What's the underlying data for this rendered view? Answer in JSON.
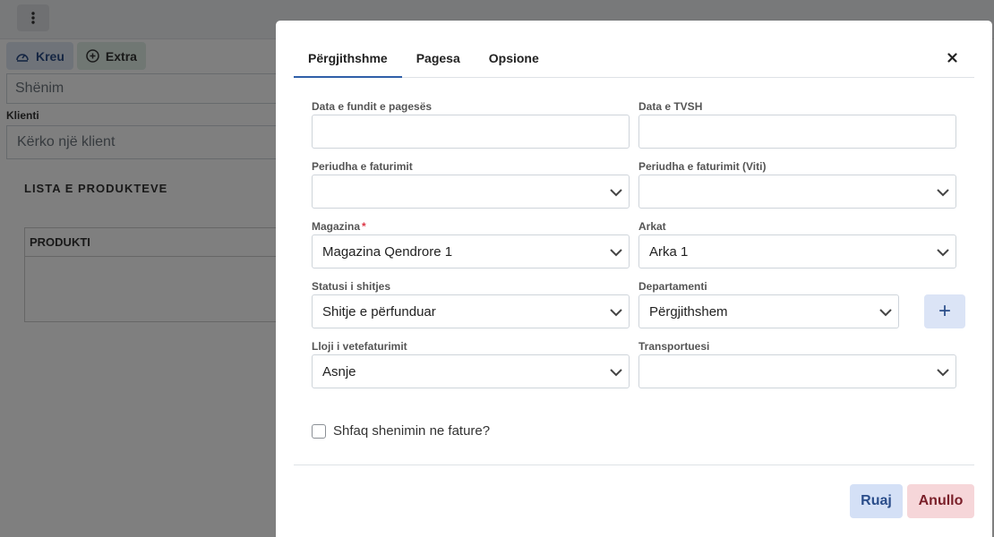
{
  "background": {
    "tabs": [
      {
        "label": "Kreu",
        "icon": "dashboard-icon"
      },
      {
        "label": "Extra",
        "icon": "plus-circle-icon"
      }
    ],
    "note_placeholder": "Shënim",
    "client_label": "Klienti",
    "client_placeholder": "Kërko një klient",
    "list_title": "LISTA E PRODUKTEVE",
    "table_header": "PRODUKTI"
  },
  "modal": {
    "tabs": [
      {
        "label": "Përgjithshme",
        "active": true
      },
      {
        "label": "Pagesa",
        "active": false
      },
      {
        "label": "Opsione",
        "active": false
      }
    ],
    "close_icon": "close-icon",
    "fields": {
      "last_payment_date": {
        "label": "Data e fundit e pagesës",
        "value": ""
      },
      "vat_date": {
        "label": "Data e TVSH",
        "value": ""
      },
      "billing_period": {
        "label": "Periudha e faturimit",
        "value": ""
      },
      "billing_period_year": {
        "label": "Periudha e faturimit (Viti)",
        "value": ""
      },
      "warehouse": {
        "label": "Magazina",
        "required_mark": "*",
        "value": "Magazina Qendrore 1"
      },
      "cash_register": {
        "label": "Arkat",
        "value": "Arka 1"
      },
      "sale_status": {
        "label": "Statusi i shitjes",
        "value": "Shitje e përfunduar"
      },
      "department": {
        "label": "Departamenti",
        "value": "Përgjithshem"
      },
      "self_invoice_type": {
        "label": "Lloji i vetefaturimit",
        "value": "Asnje"
      },
      "transporter": {
        "label": "Transportuesi",
        "value": ""
      }
    },
    "add_button_label": "+",
    "show_note_checkbox": {
      "label": "Shfaq shenimin ne fature?",
      "checked": false
    },
    "save_label": "Ruaj",
    "cancel_label": "Anullo"
  },
  "colors": {
    "accent": "#2f5fa8",
    "save_bg": "#d4e0f6",
    "cancel_bg": "#f6d6d9",
    "required": "#dc3545"
  }
}
